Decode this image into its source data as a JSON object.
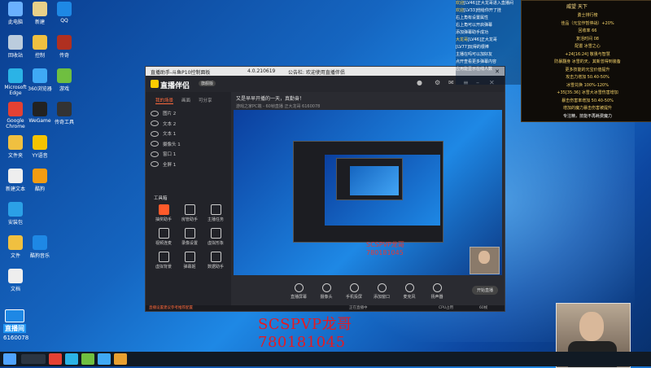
{
  "desktop_icons": [
    {
      "label": "此电脑",
      "color": "#6ab0ff"
    },
    {
      "label": "新建",
      "color": "#e8d089"
    },
    {
      "label": "QQ",
      "color": "#1e88e5"
    },
    {
      "label": "回收站",
      "color": "#bcd"
    },
    {
      "label": "控制",
      "color": "#f0c040"
    },
    {
      "label": "传奇",
      "color": "#b03020"
    },
    {
      "label": "Microsoft Edge",
      "color": "#2bb3e6"
    },
    {
      "label": "360浏览器",
      "color": "#3fa9f5"
    },
    {
      "label": "游戏",
      "color": "#6fbf40"
    },
    {
      "label": "Google Chrome",
      "color": "#e34133"
    },
    {
      "label": "WeGame",
      "color": "#222"
    },
    {
      "label": "传奇工具",
      "color": "#333"
    },
    {
      "label": "文件夹",
      "color": "#f0c040"
    },
    {
      "label": "YY语音",
      "color": "#f5c400"
    },
    {
      "label": "新建文本",
      "color": "#eee"
    },
    {
      "label": "酷狗",
      "color": "#f39c12"
    },
    {
      "label": "安装包",
      "color": "#2ba0e6"
    },
    {
      "label": "文件",
      "color": "#f0c040"
    },
    {
      "label": "酷狗音乐",
      "color": "#1e88e5"
    },
    {
      "label": "文档",
      "color": "#eee"
    }
  ],
  "app": {
    "title_left": "直播助手-斗鱼P10控制面板",
    "title_ver": "4.0.210619",
    "title_note": "公告栏: 欢迎使用直播伴侣",
    "logo": "直播伴侣",
    "version_badge": "旗舰版",
    "tabs": [
      "我的场景",
      "画面",
      "可分享"
    ],
    "scenes": [
      "图片 2",
      "文本 2",
      "文本 1",
      "摄像头 1",
      "窗口 1",
      "全屏 1"
    ],
    "tools_title": "工具箱",
    "tools": [
      {
        "label": "抽奖助手",
        "hot": true
      },
      {
        "label": "房管助手",
        "hot": false
      },
      {
        "label": "主播任务",
        "hot": false
      },
      {
        "label": "视频连麦",
        "hot": false
      },
      {
        "label": "录像设置",
        "hot": false
      },
      {
        "label": "虚拟形象",
        "hot": false
      },
      {
        "label": "虚拟背景",
        "hot": false
      },
      {
        "label": "弹幕姬",
        "hot": false
      },
      {
        "label": "数据助手",
        "hot": false
      }
    ],
    "stage_info": "又是早早开播的一天，真勤奋！",
    "stage_sub": "游戏之家PC端 - 60帧直播    正大龙哥    6160078",
    "watermark_small": "SCSPVP龙哥",
    "watermark_small_num": "780181045",
    "controls": [
      "直播屏幕",
      "摄像头",
      "手机投屏",
      "添加窗口",
      "麦克风",
      "扬声器"
    ],
    "go_live": "开始直播",
    "status_warn": "直播设置建议参考推荐配置",
    "status_mid": "正在直播中",
    "status_right": "CPU占用",
    "status_fps": "60帧"
  },
  "watermark": {
    "line1": "SCSPVP龙哥",
    "line2": "780181045"
  },
  "chat": [
    {
      "nm": "欢迎",
      "text": "[LV46]正大龙哥进入直播间"
    },
    {
      "nm": "欢迎",
      "text": "[LV33]他给你开了挂"
    },
    {
      "nm": "",
      "text": "右上角有设置属性"
    },
    {
      "nm": "",
      "text": "右上角可以开启弹幕"
    },
    {
      "nm": "",
      "text": "添加弹幕助手成功"
    },
    {
      "nm": "大龙哥",
      "text": "[LV46]正大龙哥"
    },
    {
      "nm": "",
      "text": "[LV77]玩得的很棒"
    },
    {
      "nm": "",
      "text": "主播在吗可以加好友"
    },
    {
      "nm": "",
      "text": "点开查看更多弹幕内容"
    },
    {
      "nm": "",
      "text": "应用能显示在线人数"
    }
  ],
  "board": {
    "title": "威望 天下",
    "lines": [
      "勇士排行榜",
      "佳品（元宝作暂停战）+20%",
      "回收率 66",
      "复活时间 08",
      "配置 冰雪之心",
      "+24[16:24] 敬畏与智慧",
      "防暴翻身 冰雪的天，其新曾得到装备",
      "更多技能的元宝价值提升",
      "攻击力增加 50.40-50%",
      "冰雪兑换 100%-120%",
      "+35[35:36] 冰雪大冰雪伤害增加",
      "暴击伤害率增加 50.40-50%",
      "增加的魔力暴击伤害被提升",
      "专注精，技能不再耗费魔力"
    ]
  },
  "room": {
    "live": "直播间",
    "id": "6160078"
  }
}
